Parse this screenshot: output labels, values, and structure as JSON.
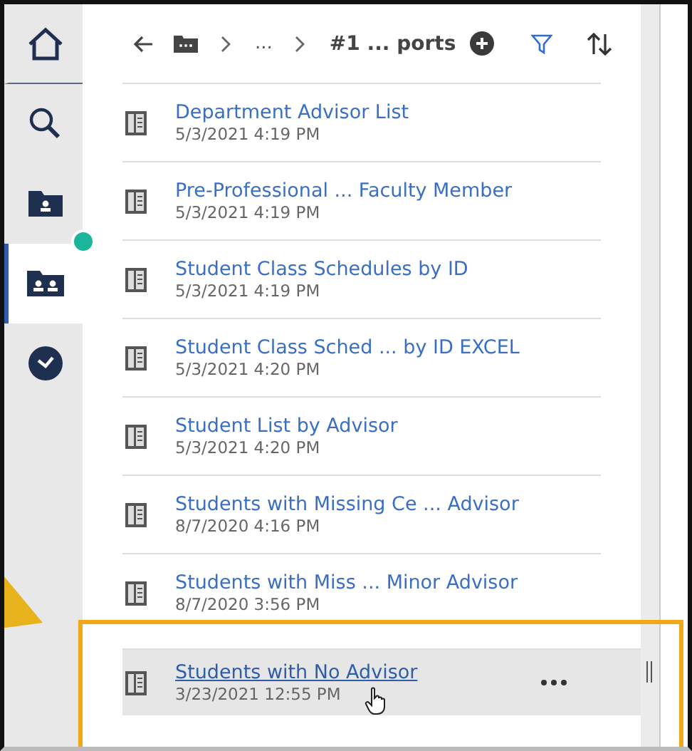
{
  "rail": [
    {
      "kind": "home",
      "selected": false
    },
    {
      "kind": "search",
      "selected": false
    },
    {
      "kind": "my-folder",
      "selected": false
    },
    {
      "kind": "team-folder",
      "selected": true,
      "badge": true
    },
    {
      "kind": "recent",
      "selected": false
    }
  ],
  "breadcrumb": {
    "ellipsis": "...",
    "current": "#1 ... ports"
  },
  "items": [
    {
      "title": "Department Advisor List",
      "date": "5/3/2021 4:19 PM",
      "hovered": false
    },
    {
      "title": "Pre-Professional ... Faculty Member",
      "date": "5/3/2021 4:19 PM",
      "hovered": false
    },
    {
      "title": "Student Class Schedules by ID",
      "date": "5/3/2021 4:19 PM",
      "hovered": false
    },
    {
      "title": "Student Class Sched ... by ID EXCEL",
      "date": "5/3/2021 4:20 PM",
      "hovered": false
    },
    {
      "title": "Student List by Advisor",
      "date": "5/3/2021 4:20 PM",
      "hovered": false
    },
    {
      "title": "Students with Missing Ce ... Advisor",
      "date": "8/7/2020 4:16 PM",
      "hovered": false
    },
    {
      "title": "Students with Miss ... Minor Advisor",
      "date": "8/7/2020 3:56 PM",
      "hovered": false
    },
    {
      "title": "Students with No Advisor",
      "date": "3/23/2021 12:55 PM",
      "hovered": true
    }
  ]
}
